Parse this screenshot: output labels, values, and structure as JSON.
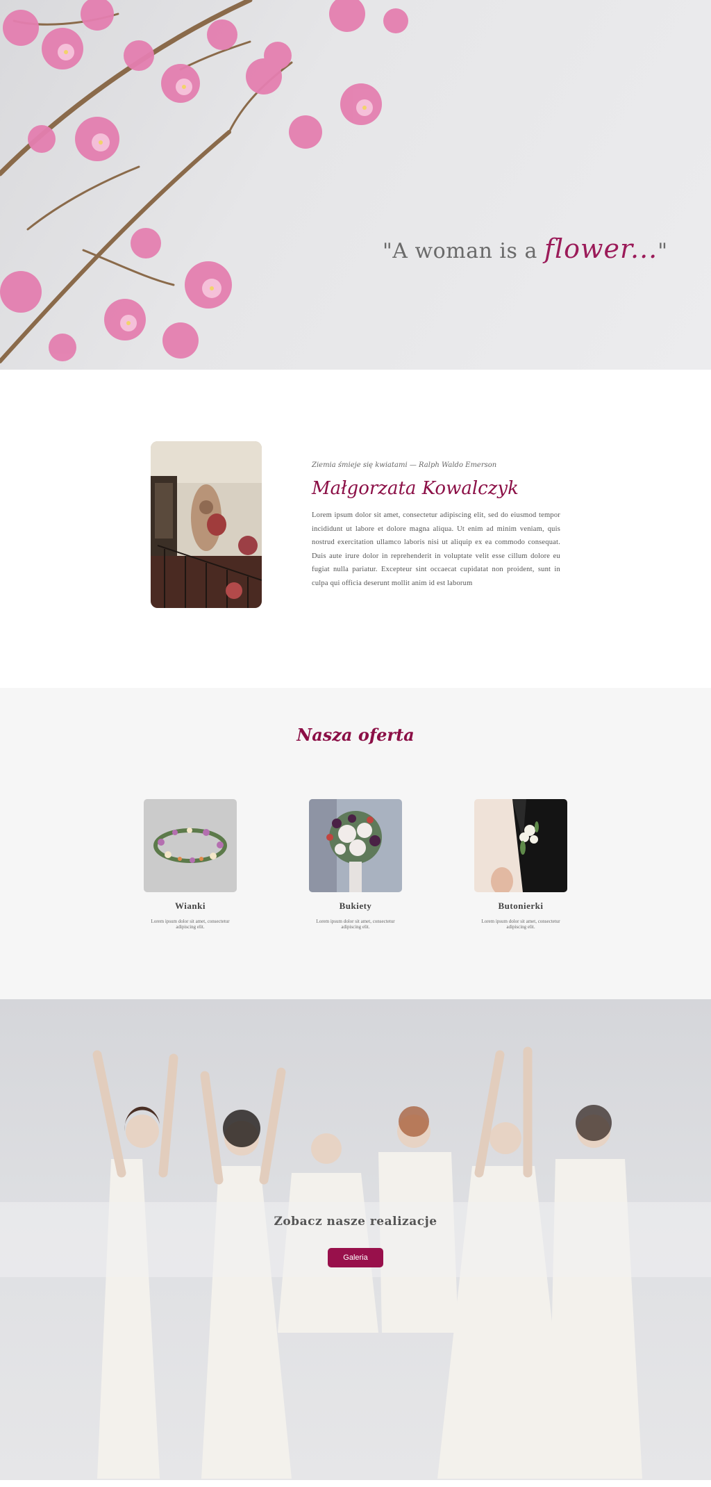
{
  "hero": {
    "quote_prefix": "\"A woman is a ",
    "quote_accent": "flower...",
    "quote_suffix": "\""
  },
  "about": {
    "caption": "Ziemia śmieje się kwiatami — Ralph Waldo Emerson",
    "name": "Małgorzata Kowalczyk",
    "body": "Lorem ipsum dolor sit amet, consectetur adipiscing elit, sed do eiusmod tempor incididunt ut labore et dolore magna aliqua. Ut enim ad minim veniam, quis nostrud exercitation ullamco laboris nisi ut aliquip ex ea commodo consequat. Duis aute irure dolor in reprehenderit in voluptate velit esse cillum dolore eu fugiat nulla pariatur. Excepteur sint occaecat cupidatat non proident, sunt in culpa qui officia deserunt mollit anim id est laborum"
  },
  "offer": {
    "title": "Nasza oferta",
    "items": [
      {
        "name": "Wianki",
        "desc": "Lorem ipsum dolor sit amet, consectetur adipiscing elit."
      },
      {
        "name": "Bukiety",
        "desc": "Lorem ipsum dolor sit amet, consectetur adipiscing elit."
      },
      {
        "name": "Butonierki",
        "desc": "Lorem ipsum dolor sit amet, consectetur adipiscing elit."
      }
    ]
  },
  "gallery": {
    "title": "Zobacz nasze realizacje",
    "button": "Galeria"
  },
  "colors": {
    "accent": "#8b0f46",
    "button": "#98104b",
    "offer_bg": "#f6f6f6"
  }
}
